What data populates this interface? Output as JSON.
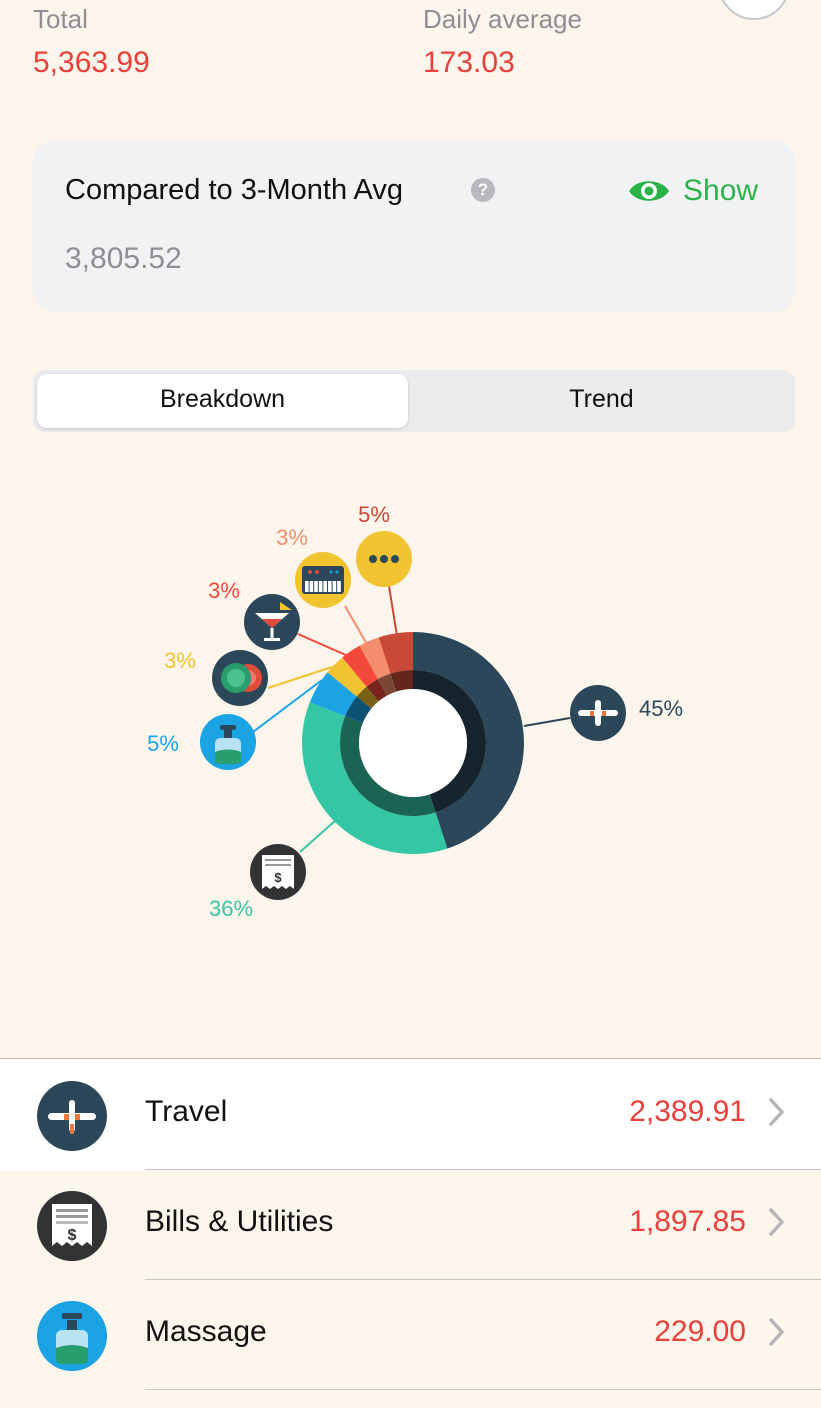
{
  "header": {
    "total_label": "Total",
    "total_value": "5,363.99",
    "daily_label": "Daily average",
    "daily_value": "173.03"
  },
  "compare": {
    "title": "Compared to 3-Month Avg",
    "help": "?",
    "show_label": "Show",
    "value": "3,805.52"
  },
  "tabs": [
    {
      "label": "Breakdown",
      "active": true
    },
    {
      "label": "Trend",
      "active": false
    }
  ],
  "colors": {
    "accent_green": "#2bb34a",
    "negative_red": "#e8403a"
  },
  "chart_data": {
    "type": "pie",
    "style": "donut",
    "slices": [
      {
        "category": "Travel",
        "percent": 45,
        "label": "45%",
        "color": "#2c4759",
        "icon": "airplane-icon"
      },
      {
        "category": "Bills & Utilities",
        "percent": 36,
        "label": "36%",
        "color": "#35c6a4",
        "icon": "receipt-icon"
      },
      {
        "category": "Massage",
        "percent": 5,
        "label": "5%",
        "color": "#1ba3e4",
        "icon": "lotion-bottle-icon"
      },
      {
        "category": "",
        "percent": 3,
        "label": "3%",
        "color": "#f0c330",
        "icon": "casino-chips-icon"
      },
      {
        "category": "",
        "percent": 3,
        "label": "3%",
        "color": "#f2493a",
        "icon": "cocktail-icon"
      },
      {
        "category": "",
        "percent": 3,
        "label": "3%",
        "color": "#f48d6e",
        "icon": "keyboard-synth-icon"
      },
      {
        "category": "",
        "percent": 5,
        "label": "5%",
        "color": "#c84a36",
        "icon": "more-dots-icon"
      }
    ]
  },
  "list": [
    {
      "label": "Travel",
      "value": "2,389.91",
      "icon": "airplane-icon"
    },
    {
      "label": "Bills & Utilities",
      "value": "1,897.85",
      "icon": "receipt-icon"
    },
    {
      "label": "Massage",
      "value": "229.00",
      "icon": "lotion-bottle-icon"
    }
  ]
}
